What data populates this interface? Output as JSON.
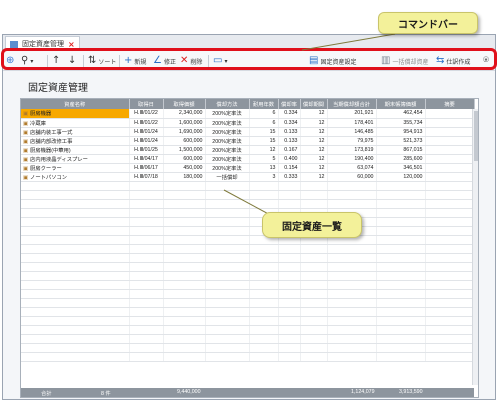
{
  "tab": {
    "label": "固定資産管理",
    "close": "×"
  },
  "toolbar": {
    "search_icon": "magnifier-icon",
    "sort": "ソート",
    "add": "新規",
    "edit": "修正",
    "delete": "削除",
    "settings": "固定資産設定",
    "bulk_depreciation": "一括償却資産",
    "create_entry": "仕訳作成"
  },
  "page_title": "固定資産管理",
  "table": {
    "headers": [
      "資産名称",
      "取得日",
      "取得価額",
      "償却方法",
      "耐用年数",
      "償却率",
      "償却期間",
      "当期償却額合計",
      "期末帳簿価額",
      "摘要"
    ],
    "rows": [
      [
        "厨房機器",
        "H.Ⅲ/01/22",
        "2,340,000",
        "200%定率法",
        "6",
        "0.334",
        "12",
        "201,921",
        "462,454",
        ""
      ],
      [
        "冷蔵庫",
        "H.Ⅲ/01/22",
        "1,600,000",
        "200%定率法",
        "6",
        "0.334",
        "12",
        "178,401",
        "355,734",
        ""
      ],
      [
        "店舗内装工事一式",
        "H.Ⅲ/01/24",
        "1,690,000",
        "200%定率法",
        "15",
        "0.133",
        "12",
        "146,485",
        "954,913",
        ""
      ],
      [
        "店舗内部改修工事",
        "H.Ⅲ/01/24",
        "600,000",
        "200%定率法",
        "15",
        "0.133",
        "12",
        "79,975",
        "521,373",
        ""
      ],
      [
        "厨房機器(中華用)",
        "H.Ⅲ/01/25",
        "1,500,000",
        "200%定率法",
        "12",
        "0.167",
        "12",
        "173,819",
        "867,015",
        ""
      ],
      [
        "店内用液晶ディスプレー",
        "H.Ⅲ/04/17",
        "600,000",
        "200%定率法",
        "5",
        "0.400",
        "12",
        "190,400",
        "285,600",
        ""
      ],
      [
        "厨房クーラー",
        "H.Ⅲ/06/17",
        "450,000",
        "200%定率法",
        "13",
        "0.154",
        "12",
        "63,074",
        "346,501",
        ""
      ],
      [
        "ノートパソコン",
        "H.Ⅲ/07/18",
        "180,000",
        "一括償却",
        "3",
        "0.333",
        "12",
        "60,000",
        "120,000",
        ""
      ]
    ]
  },
  "footer": {
    "label": "合計",
    "count": "8 件",
    "total_cost": "9,440,000",
    "total_depreciation": "1,124,079",
    "total_book_value": "3,913,590"
  },
  "callouts": {
    "command_bar": "コマンドバー",
    "asset_list": "固定資産一覧"
  },
  "colors": {
    "highlight_border": "#e0101b",
    "selected_row": "#f7a800",
    "callout_bg": "#f3f19a",
    "header_bg": "#8d959e"
  }
}
